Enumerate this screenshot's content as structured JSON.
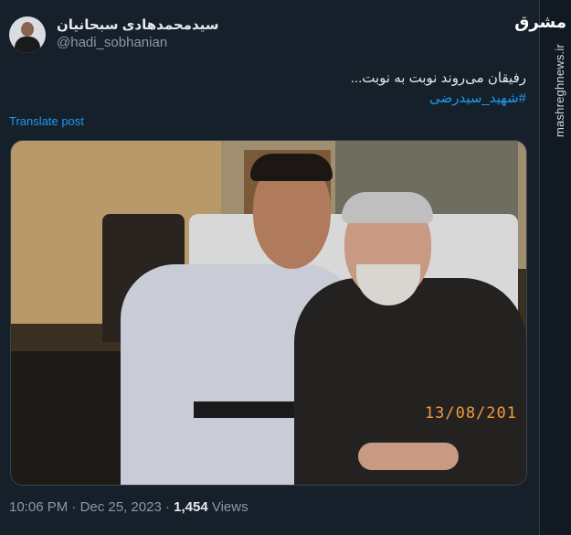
{
  "author": {
    "display_name": "سیدمحمدهادی سبحانیان",
    "handle": "@hadi_sobhanian"
  },
  "tweet": {
    "text": "رفیقان می‌روند نوبت به نوبت...",
    "hashtag": "#شهید_سیدرضی",
    "translate_label": "Translate post",
    "photo_datestamp": "13/08/201"
  },
  "meta": {
    "time": "10:06 PM",
    "separator": "·",
    "date": "Dec 25, 2023",
    "views_count": "1,454",
    "views_label": "Views"
  },
  "watermark": {
    "logo": "مشرق",
    "site": "mashreghnews.ir"
  }
}
